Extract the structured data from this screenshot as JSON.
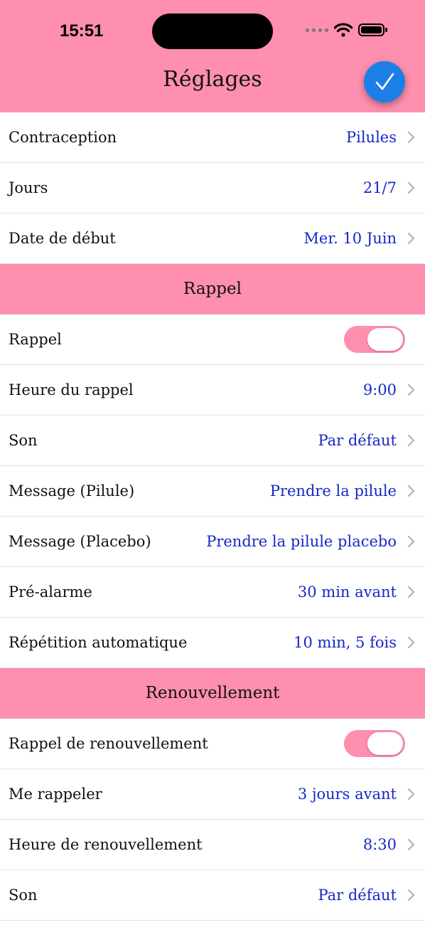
{
  "status_bar": {
    "time": "15:51"
  },
  "nav": {
    "title": "Réglages"
  },
  "general": [
    {
      "label": "Contraception",
      "value": "Pilules"
    },
    {
      "label": "Jours",
      "value": "21/7"
    },
    {
      "label": "Date de début",
      "value": "Mer. 10 Juin"
    }
  ],
  "reminder": {
    "title": "Rappel",
    "toggle": {
      "label": "Rappel",
      "on": true
    },
    "rows": [
      {
        "label": "Heure du rappel",
        "value": "9:00"
      },
      {
        "label": "Son",
        "value": "Par défaut"
      },
      {
        "label": "Message (Pilule)",
        "value": "Prendre la pilule"
      },
      {
        "label": "Message (Placebo)",
        "value": "Prendre la pilule placebo"
      },
      {
        "label": "Pré-alarme",
        "value": "30 min avant"
      },
      {
        "label": "Répétition automatique",
        "value": "10 min, 5 fois"
      }
    ]
  },
  "renewal": {
    "title": "Renouvellement",
    "toggle": {
      "label": "Rappel de renouvellement",
      "on": true
    },
    "rows": [
      {
        "label": "Me rappeler",
        "value": "3 jours avant"
      },
      {
        "label": "Heure de renouvellement",
        "value": "8:30"
      },
      {
        "label": "Son",
        "value": "Par défaut"
      }
    ]
  },
  "icons": {
    "done": "checkmark-icon",
    "chevron": "chevron-right-icon",
    "wifi": "wifi-icon",
    "battery": "battery-icon"
  },
  "colors": {
    "accent_pink": "#ff8fae",
    "value_blue": "#1428c8",
    "done_blue": "#1c7fe8"
  }
}
